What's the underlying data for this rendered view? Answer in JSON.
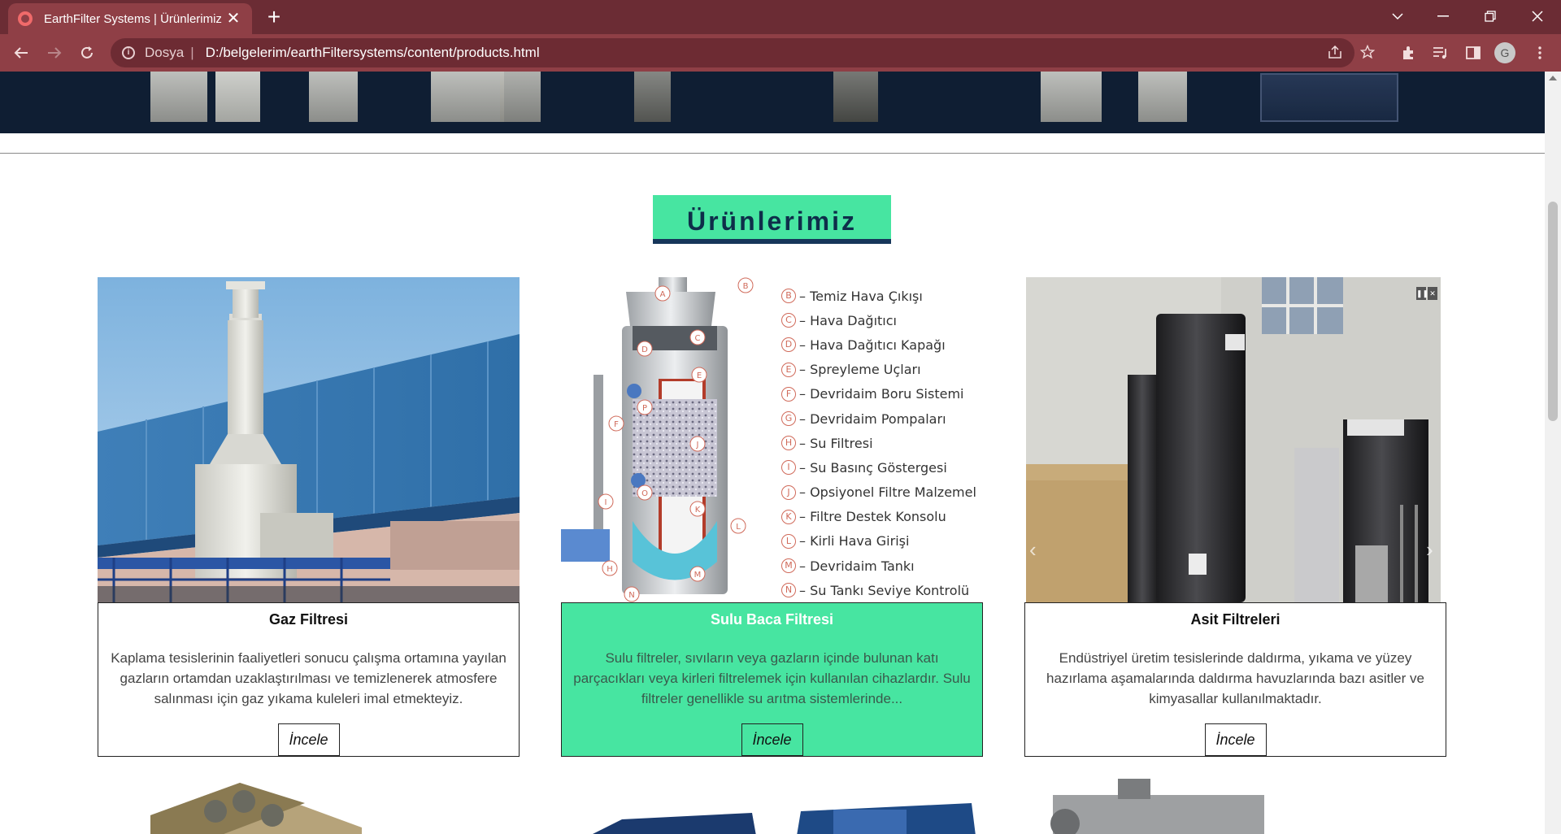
{
  "browser": {
    "tab_title": "EarthFilter Systems | Ürünlerimiz",
    "tab_close": "✕",
    "new_tab": "+",
    "address_scheme": "Dosya",
    "address_sep": "|",
    "address_url": "D:/belgelerim/earthFiltersystems/content/products.html",
    "profile_initial": "G",
    "window_controls": [
      "minimize-icon",
      "restore-icon",
      "close-icon"
    ]
  },
  "page": {
    "section_title": "Ürünlerimiz",
    "products": [
      {
        "name": "Gaz Filtresi",
        "description": "Kaplama tesislerinin faaliyetleri sonucu çalışma ortamına yayılan gazların ortamdan uzaklaştırılması ve temizlenerek atmosfere salınması için gaz yıkama kuleleri imal etmekteyiz.",
        "button": "İncele",
        "active": false
      },
      {
        "name": "Sulu Baca Filtresi",
        "description": "Sulu filtreler, sıvıların veya gazların içinde bulunan katı parçacıkları veya kirleri filtrelemek için kullanılan cihazlardır. Sulu filtreler genellikle su arıtma sistemlerinde...",
        "button": "İncele",
        "active": true
      },
      {
        "name": "Asit Filtreleri",
        "description": "Endüstriyel üretim tesislerinde daldırma, yıkama ve yüzey hazırlama aşamalarında daldırma havuzlarında bazı asitler ve kimyasallar kullanılmaktadır.",
        "button": "İncele",
        "active": false
      }
    ],
    "diagram_parts": [
      {
        "letter": "B",
        "label": "– Temiz Hava Çıkışı"
      },
      {
        "letter": "C",
        "label": "– Hava Dağıtıcı"
      },
      {
        "letter": "D",
        "label": "– Hava Dağıtıcı Kapağı"
      },
      {
        "letter": "E",
        "label": "– Spreyleme Uçları"
      },
      {
        "letter": "F",
        "label": "– Devridaim Boru Sistemi"
      },
      {
        "letter": "G",
        "label": "– Devridaim Pompaları"
      },
      {
        "letter": "H",
        "label": "– Su Filtresi"
      },
      {
        "letter": "I",
        "label": "– Su Basınç Göstergesi"
      },
      {
        "letter": "J",
        "label": "– Opsiyonel Filtre Malzemel"
      },
      {
        "letter": "K",
        "label": "– Filtre Destek Konsolu"
      },
      {
        "letter": "L",
        "label": "– Kirli Hava Girişi"
      },
      {
        "letter": "M",
        "label": "– Devridaim Tankı"
      },
      {
        "letter": "N",
        "label": "– Su Tankı Seviye Kontrolü"
      }
    ],
    "diagram_callouts": [
      "A",
      "B",
      "C",
      "D",
      "E",
      "P",
      "F",
      "J",
      "I",
      "O",
      "K",
      "L",
      "H",
      "M",
      "N"
    ]
  },
  "colors": {
    "accent": "#47e5a1",
    "title_underline": "#16365a",
    "chrome_tabbar": "#6b2c34",
    "chrome_toolbar": "#8f3f46"
  }
}
